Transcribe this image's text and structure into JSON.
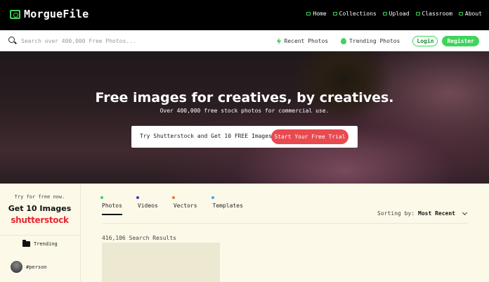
{
  "brand": {
    "name": "MorgueFile",
    "accent": "#3fd45c"
  },
  "nav": {
    "links": [
      {
        "label": "Home"
      },
      {
        "label": "Collections"
      },
      {
        "label": "Upload"
      },
      {
        "label": "Classroom"
      },
      {
        "label": "About"
      }
    ]
  },
  "search": {
    "placeholder": "Search over 400,000 Free Photos...",
    "recent_label": "Recent Photos",
    "trending_label": "Trending Photos",
    "login_label": "Login",
    "register_label": "Register"
  },
  "hero": {
    "title": "Free images for creatives, by creatives.",
    "subtitle": "Over 400,000 free stock photos for commercial use.",
    "promo_text": "Try Shutterstock and Get 10 FREE Images",
    "cta_label": "Start Your Free Trial",
    "cta_color": "#e84a4f"
  },
  "sidebar": {
    "promo_small": "Try for free now.",
    "promo_big": "Get 10 Images",
    "sponsor_logo": "shutterstock",
    "trending_label": "Trending",
    "tag_label": "#person"
  },
  "main": {
    "tabs": [
      {
        "label": "Photos",
        "dot_color": "#3fd45c",
        "active": true
      },
      {
        "label": "Videos",
        "dot_color": "#5a2fb5",
        "active": false
      },
      {
        "label": "Vectors",
        "dot_color": "#e07b2a",
        "active": false
      },
      {
        "label": "Templates",
        "dot_color": "#2fb5d6",
        "active": false
      }
    ],
    "sorting_label": "Sorting by:",
    "sorting_value": "Most Recent",
    "results_text": "416,106 Search Results"
  }
}
